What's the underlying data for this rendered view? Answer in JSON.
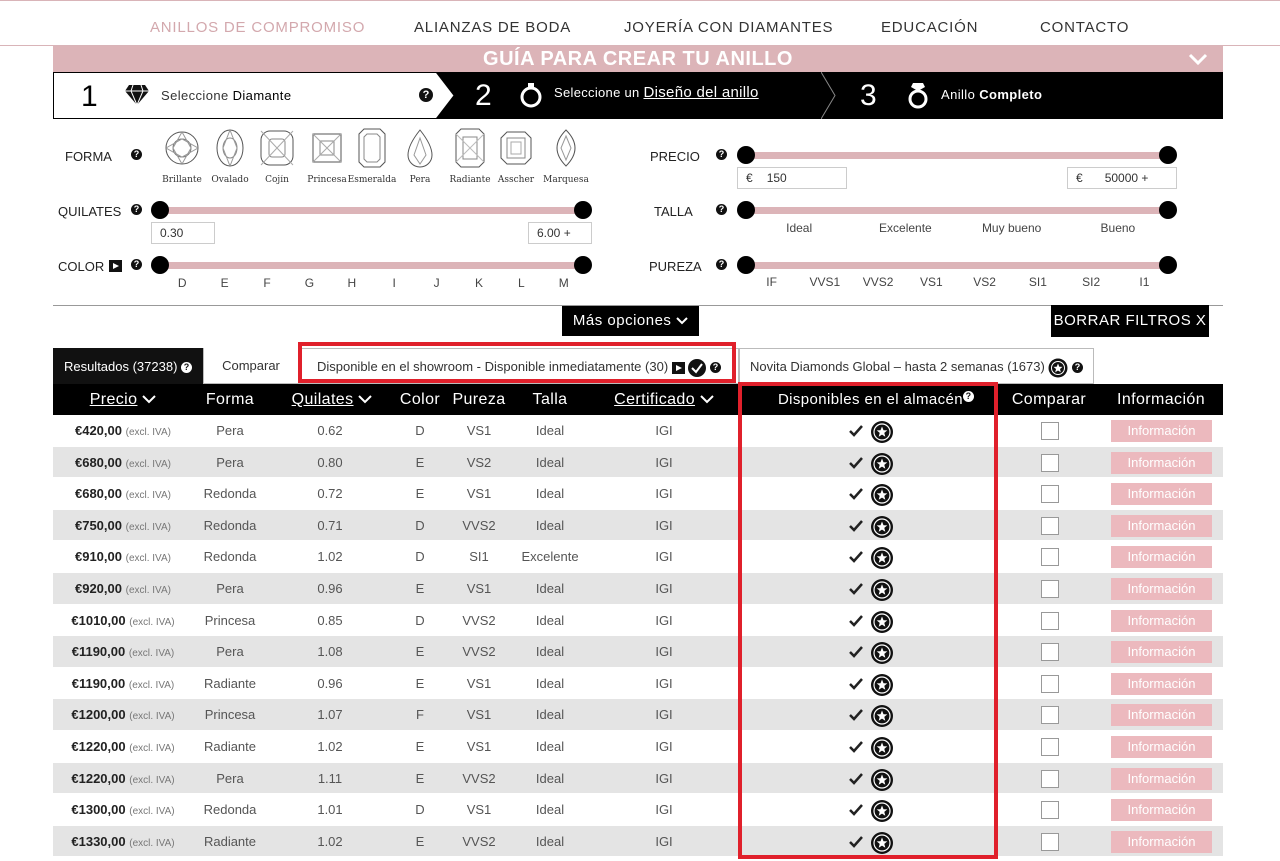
{
  "nav": {
    "items": [
      "ANILLOS DE COMPROMISO",
      "ALIANZAS DE BODA",
      "JOYERÍA CON DIAMANTES",
      "EDUCACIÓN",
      "CONTACTO"
    ],
    "active_index": 0
  },
  "guide": {
    "title": "GUÍA PARA CREAR TU ANILLO"
  },
  "steps": [
    {
      "num": "1",
      "pre": "Seleccione ",
      "strong": "Diamante"
    },
    {
      "num": "2",
      "pre": "Seleccione un ",
      "link": "Diseño del anillo"
    },
    {
      "num": "3",
      "pre": "Anillo ",
      "strong": "Completo"
    }
  ],
  "filters": {
    "forma_label": "FORMA",
    "shapes": [
      "Brillante",
      "Ovalado",
      "Cojín",
      "Princesa",
      "Esmeralda",
      "Pera",
      "Radiante",
      "Asscher",
      "Marquesa"
    ],
    "quilates_label": "QUILATES",
    "quilates_min": "0.30",
    "quilates_max": "6.00 +",
    "color_label": "COLOR",
    "color_ticks": [
      "D",
      "E",
      "F",
      "G",
      "H",
      "I",
      "J",
      "K",
      "L",
      "M"
    ],
    "precio_label": "PRECIO",
    "precio_currency": "€",
    "precio_min": "150",
    "precio_max": "50000 +",
    "talla_label": "TALLA",
    "talla_ticks": [
      "Ideal",
      "Excelente",
      "Muy bueno",
      "Bueno"
    ],
    "pureza_label": "PUREZA",
    "pureza_ticks": [
      "IF",
      "VVS1",
      "VVS2",
      "VS1",
      "VS2",
      "SI1",
      "SI2",
      "I1"
    ]
  },
  "buttons": {
    "mas_opciones": "Más opciones",
    "borrar_filtros": "BORRAR FILTROS X"
  },
  "tabs": {
    "resultados": "Resultados (37238)",
    "comparar": "Comparar",
    "showroom": "Disponible en el showroom - Disponible inmediatamente (30)",
    "global": "Novita Diamonds Global – hasta 2 semanas (1673)"
  },
  "table": {
    "headers": {
      "precio": "Precio",
      "forma": "Forma",
      "quilates": "Quilates",
      "color": "Color",
      "pureza": "Pureza",
      "talla": "Talla",
      "certificado": "Certificado",
      "almacen": "Disponibles en el almacén",
      "comparar": "Comparar",
      "informacion": "Información"
    },
    "excl": "(excl. IVA)",
    "info_label": "Información",
    "rows": [
      {
        "price": "€420,00",
        "forma": "Pera",
        "quilates": "0.62",
        "color": "D",
        "pureza": "VS1",
        "talla": "Ideal",
        "cert": "IGI"
      },
      {
        "price": "€680,00",
        "forma": "Pera",
        "quilates": "0.80",
        "color": "E",
        "pureza": "VS2",
        "talla": "Ideal",
        "cert": "IGI"
      },
      {
        "price": "€680,00",
        "forma": "Redonda",
        "quilates": "0.72",
        "color": "E",
        "pureza": "VS1",
        "talla": "Ideal",
        "cert": "IGI"
      },
      {
        "price": "€750,00",
        "forma": "Redonda",
        "quilates": "0.71",
        "color": "D",
        "pureza": "VVS2",
        "talla": "Ideal",
        "cert": "IGI"
      },
      {
        "price": "€910,00",
        "forma": "Redonda",
        "quilates": "1.02",
        "color": "D",
        "pureza": "SI1",
        "talla": "Excelente",
        "cert": "IGI"
      },
      {
        "price": "€920,00",
        "forma": "Pera",
        "quilates": "0.96",
        "color": "E",
        "pureza": "VS1",
        "talla": "Ideal",
        "cert": "IGI"
      },
      {
        "price": "€1010,00",
        "forma": "Princesa",
        "quilates": "0.85",
        "color": "D",
        "pureza": "VVS2",
        "talla": "Ideal",
        "cert": "IGI"
      },
      {
        "price": "€1190,00",
        "forma": "Pera",
        "quilates": "1.08",
        "color": "E",
        "pureza": "VVS2",
        "talla": "Ideal",
        "cert": "IGI"
      },
      {
        "price": "€1190,00",
        "forma": "Radiante",
        "quilates": "0.96",
        "color": "E",
        "pureza": "VS1",
        "talla": "Ideal",
        "cert": "IGI"
      },
      {
        "price": "€1200,00",
        "forma": "Princesa",
        "quilates": "1.07",
        "color": "F",
        "pureza": "VS1",
        "talla": "Ideal",
        "cert": "IGI"
      },
      {
        "price": "€1220,00",
        "forma": "Radiante",
        "quilates": "1.02",
        "color": "E",
        "pureza": "VS1",
        "talla": "Ideal",
        "cert": "IGI"
      },
      {
        "price": "€1220,00",
        "forma": "Pera",
        "quilates": "1.11",
        "color": "E",
        "pureza": "VVS2",
        "talla": "Ideal",
        "cert": "IGI"
      },
      {
        "price": "€1300,00",
        "forma": "Redonda",
        "quilates": "1.01",
        "color": "D",
        "pureza": "VS1",
        "talla": "Ideal",
        "cert": "IGI"
      },
      {
        "price": "€1330,00",
        "forma": "Radiante",
        "quilates": "1.02",
        "color": "E",
        "pureza": "VVS2",
        "talla": "Ideal",
        "cert": "IGI"
      }
    ]
  },
  "colors": {
    "accent_pink": "#dcb4b8",
    "info_button": "#ecb9be",
    "highlight_red": "#e0202b",
    "dark": "#000000"
  }
}
